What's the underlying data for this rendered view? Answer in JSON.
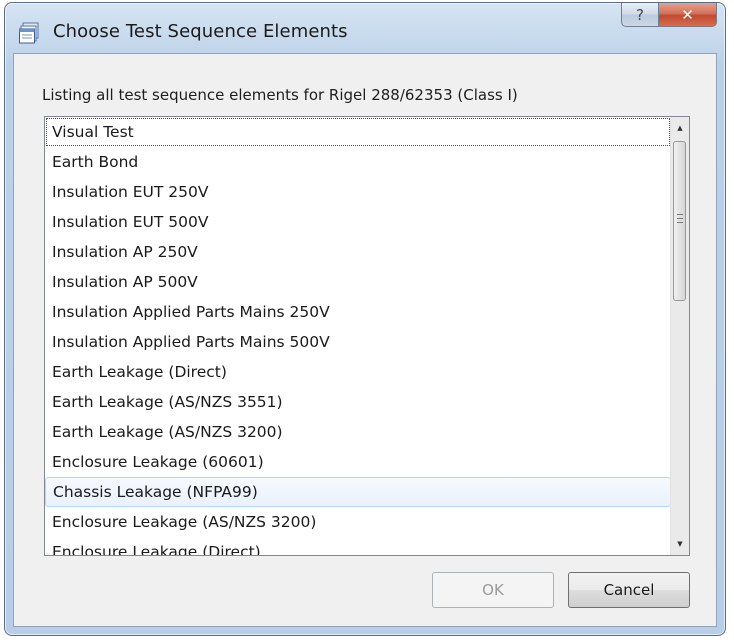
{
  "window": {
    "title": "Choose Test Sequence Elements",
    "help_label": "?",
    "close_label": "✕",
    "icon": "window-app-icon"
  },
  "heading": "Listing all test sequence elements for Rigel 288/62353 (Class I)",
  "list": {
    "items": [
      "Visual Test",
      "Earth Bond",
      "Insulation EUT 250V",
      "Insulation EUT 500V",
      "Insulation AP 250V",
      "Insulation AP 500V",
      "Insulation Applied Parts Mains 250V",
      "Insulation Applied Parts Mains 500V",
      "Earth Leakage (Direct)",
      "Earth Leakage (AS/NZS 3551)",
      "Earth Leakage (AS/NZS 3200)",
      "Enclosure Leakage (60601)",
      "Chassis Leakage (NFPA99)",
      "Enclosure Leakage (AS/NZS 3200)",
      "Enclosure Leakage (Direct)"
    ],
    "focused_index": 0,
    "hover_index": 12,
    "scroll_position": 0.0
  },
  "buttons": {
    "ok_label": "OK",
    "ok_enabled": false,
    "cancel_label": "Cancel"
  },
  "colors": {
    "titlebar": "#c5d8ec",
    "close_button": "#c14a2f",
    "hover_border": "#b8d6fb"
  }
}
